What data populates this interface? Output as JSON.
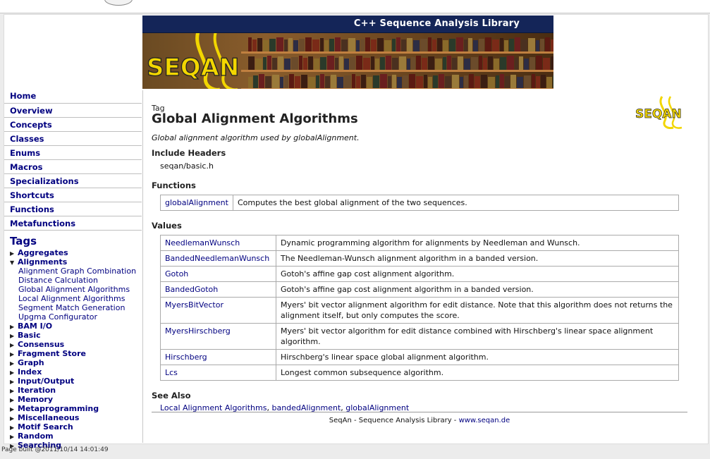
{
  "banner": {
    "title": "C++ Sequence Analysis Library",
    "logo_text": "SEQAN"
  },
  "small_logo_text": "SEQAN",
  "nav": {
    "items": [
      "Home",
      "Overview",
      "Concepts",
      "Classes",
      "Enums",
      "Macros",
      "Specializations",
      "Shortcuts",
      "Functions",
      "Metafunctions"
    ],
    "tags_heading": "Tags",
    "tags": {
      "aggregates": "Aggregates",
      "alignments": "Alignments",
      "alignments_children": [
        "Alignment Graph Combination",
        "Distance Calculation",
        "Global Alignment Algorithms",
        "Local Alignment Algorithms",
        "Segment Match Generation",
        "Upgma Configurator"
      ],
      "rest": [
        "BAM I/O",
        "Basic",
        "Consensus",
        "Fragment Store",
        "Graph",
        "Index",
        "Input/Output",
        "Iteration",
        "Memory",
        "Metaprogramming",
        "Miscellaneous",
        "Motif Search",
        "Random",
        "Searching"
      ]
    }
  },
  "content": {
    "kind": "Tag",
    "title": "Global Alignment Algorithms",
    "summary": "Global alignment algorithm used by globalAlignment.",
    "include_headers_heading": "Include Headers",
    "include_header": "seqan/basic.h",
    "functions_heading": "Functions",
    "functions": [
      {
        "name": "globalAlignment",
        "desc": "Computes the best global alignment of the two sequences."
      }
    ],
    "values_heading": "Values",
    "values": [
      {
        "name": "NeedlemanWunsch",
        "desc": "Dynamic programming algorithm for alignments by Needleman and Wunsch."
      },
      {
        "name": "BandedNeedlemanWunsch",
        "desc": "The Needleman-Wunsch alignment algorithm in a banded version."
      },
      {
        "name": "Gotoh",
        "desc": "Gotoh's affine gap cost alignment algorithm."
      },
      {
        "name": "BandedGotoh",
        "desc": "Gotoh's affine gap cost alignment algorithm in a banded version."
      },
      {
        "name": "MyersBitVector",
        "desc": "Myers' bit vector alignment algorithm for edit distance. Note that this algorithm does not returns the alignment itself, but only computes the score."
      },
      {
        "name": "MyersHirschberg",
        "desc": "Myers' bit vector algorithm for edit distance combined with Hirschberg's linear space alignment algorithm."
      },
      {
        "name": "Hirschberg",
        "desc": "Hirschberg's linear space global alignment algorithm."
      },
      {
        "name": "Lcs",
        "desc": "Longest common subsequence algorithm."
      }
    ],
    "see_also_heading": "See Also",
    "see_also": {
      "link1": "Local Alignment Algorithms",
      "link2": "bandedAlignment",
      "link3": "globalAlignment"
    }
  },
  "footer": {
    "text": "SeqAn - Sequence Analysis Library - ",
    "link": "www.seqan.de"
  },
  "build_info": "Page built @2011/10/14 14:01:49",
  "colors": {
    "link": "#000080",
    "banner_bar": "#142558",
    "logo_yellow": "#f2d600"
  }
}
